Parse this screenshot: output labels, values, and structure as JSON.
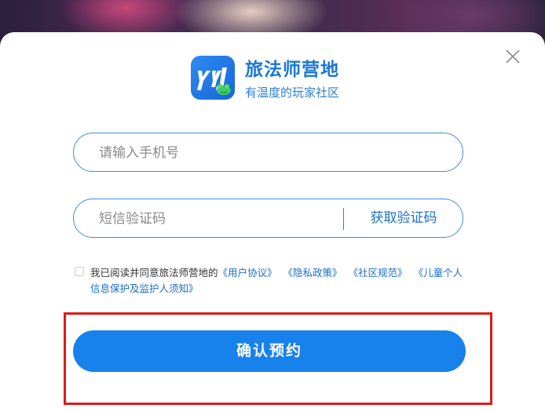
{
  "brand": {
    "title": "旅法师营地",
    "subtitle": "有温度的玩家社区",
    "logo_icon": "yj-app-logo-icon",
    "color": "#1877d6"
  },
  "close_icon": "close-icon",
  "form": {
    "phone_placeholder": "请输入手机号",
    "phone_value": "",
    "sms_placeholder": "短信验证码",
    "sms_value": "",
    "get_code_label": "获取验证码"
  },
  "agreement": {
    "checked": false,
    "prefix": "我已阅读并同意旅法师营地的",
    "links": [
      "《用户协议》",
      "《隐私政策》",
      "《社区规范》",
      "《儿童个人信息保护及监护人须知》"
    ]
  },
  "submit_label": "确认预约",
  "colors": {
    "accent": "#1781ec",
    "link": "#1a6fc9",
    "highlight": "#e01818"
  }
}
